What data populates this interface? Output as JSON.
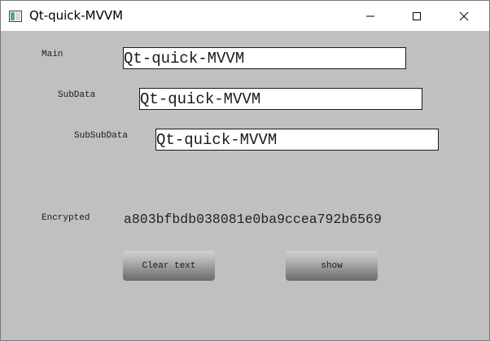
{
  "window": {
    "title": "Qt-quick-MVVM",
    "controls": {
      "minimize": "minimize-icon",
      "maximize": "maximize-icon",
      "close": "close-icon"
    }
  },
  "form": {
    "main": {
      "label": "Main",
      "value": "Qt-quick-MVVM"
    },
    "subdata": {
      "label": "SubData",
      "value": "Qt-quick-MVVM"
    },
    "subsubdata": {
      "label": "SubSubData",
      "value": "Qt-quick-MVVM"
    },
    "encrypted": {
      "label": "Encrypted",
      "value": "a803bfbdb038081e0ba9ccea792b6569"
    }
  },
  "buttons": {
    "clear_label": "Clear text",
    "show_label": "show"
  },
  "colors": {
    "client_background": "#c0c0c0",
    "titlebar_background": "#ffffff",
    "field_background": "#ffffff",
    "button_gradient_top": "#d2d2d2",
    "button_gradient_bottom": "#6a6a6a"
  }
}
